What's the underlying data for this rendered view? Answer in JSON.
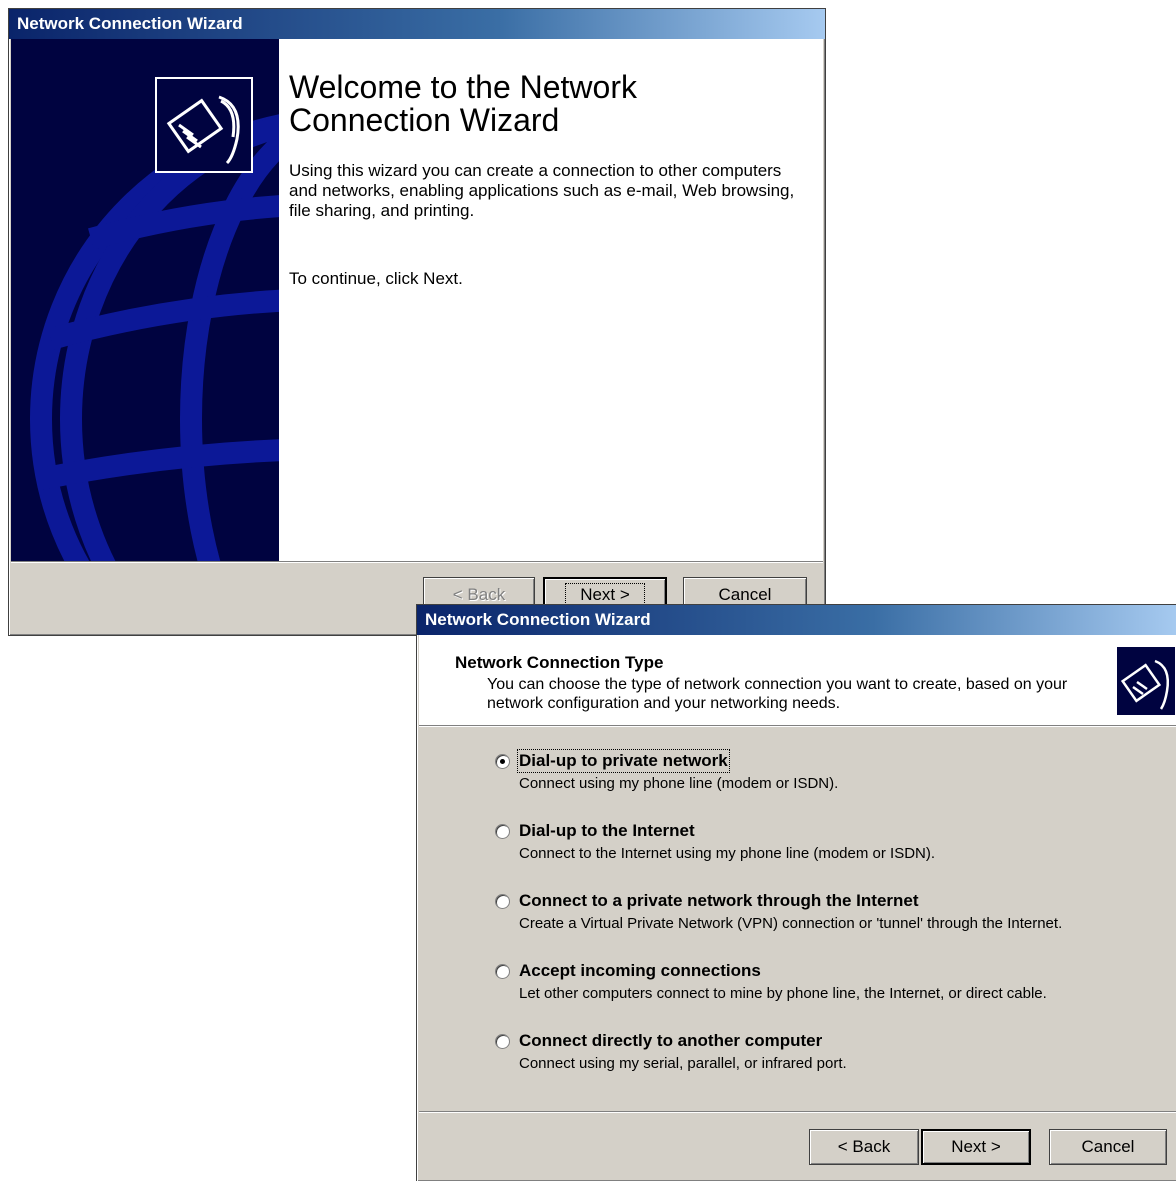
{
  "window1": {
    "title": "Network Connection Wizard",
    "heading": "Welcome to the Network Connection Wizard",
    "body": "Using this wizard you can create a connection to other computers and networks, enabling applications such as e-mail, Web browsing, file sharing, and printing.",
    "continue_text": "To continue, click Next.",
    "buttons": {
      "back": "< Back",
      "next": "Next >",
      "cancel": "Cancel"
    }
  },
  "window2": {
    "title": "Network Connection Wizard",
    "header_title": "Network Connection Type",
    "header_subtitle": "You can choose the type of network connection you want to create, based on your network configuration and your networking needs.",
    "options": [
      {
        "label": "Dial-up to private network",
        "description": "Connect using my phone line (modem or ISDN).",
        "selected": true
      },
      {
        "label": "Dial-up to the Internet",
        "description": "Connect to the Internet using my phone line (modem or ISDN).",
        "selected": false
      },
      {
        "label": "Connect to a private network through the Internet",
        "description": "Create a Virtual Private Network (VPN) connection or 'tunnel' through the Internet.",
        "selected": false
      },
      {
        "label": "Accept incoming connections",
        "description": "Let other computers connect to mine by phone line, the Internet, or direct cable.",
        "selected": false
      },
      {
        "label": "Connect directly to another computer",
        "description": "Connect using my serial, parallel, or infrared port.",
        "selected": false
      }
    ],
    "buttons": {
      "back": "< Back",
      "next": "Next >",
      "cancel": "Cancel"
    }
  },
  "icons": {
    "wizard_logo": "network-cable-icon",
    "globe": "globe-graphic",
    "radio": "radio-icon"
  },
  "colors": {
    "titlebar_start": "#0a246a",
    "titlebar_end": "#a6caf0",
    "banner": "#000340",
    "dialog_face": "#d4d0c8"
  }
}
